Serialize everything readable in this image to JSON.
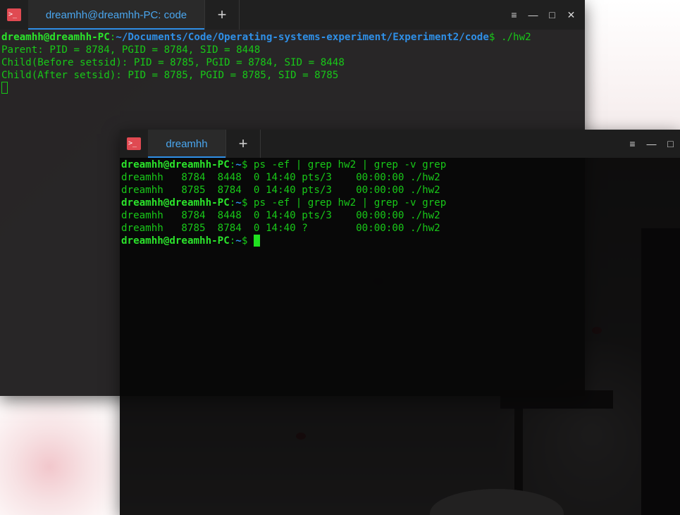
{
  "back_window": {
    "tab_title": "dreamhh@dreamhh-PC: code",
    "lines": [
      {
        "user": "dreamhh@dreamhh-PC",
        "sep": ":",
        "path": "~/Documents/Code/Operating-systems-experiment/Experiment2/code",
        "prompt": "$",
        "cmd": " ./hw2"
      },
      {
        "text": "Parent: PID = 8784, PGID = 8784, SID = 8448"
      },
      {
        "text": "Child(Before setsid): PID = 8785, PGID = 8784, SID = 8448"
      },
      {
        "text": "Child(After setsid): PID = 8785, PGID = 8785, SID = 8785"
      }
    ]
  },
  "front_window": {
    "tab_title": "dreamhh",
    "prompt_user": "dreamhh@dreamhh-PC",
    "prompt_sep": ":",
    "prompt_path": "~",
    "prompt_symbol": "$",
    "command": " ps -ef | grep hw2 | grep -v grep",
    "output1": [
      "dreamhh   8784  8448  0 14:40 pts/3    00:00:00 ./hw2",
      "dreamhh   8785  8784  0 14:40 pts/3    00:00:00 ./hw2"
    ],
    "output2": [
      "dreamhh   8784  8448  0 14:40 pts/3    00:00:00 ./hw2",
      "dreamhh   8785  8784  0 14:40 ?        00:00:00 ./hw2"
    ]
  },
  "icons": {
    "app": "terminal-icon",
    "add_tab": "+",
    "menu": "≡",
    "minimize": "—",
    "maximize": "□",
    "close": "✕"
  },
  "colors": {
    "green": "#18c818",
    "blue": "#2f8fe6",
    "tab_text": "#4aa7f0",
    "icon_red": "#e04a52"
  }
}
